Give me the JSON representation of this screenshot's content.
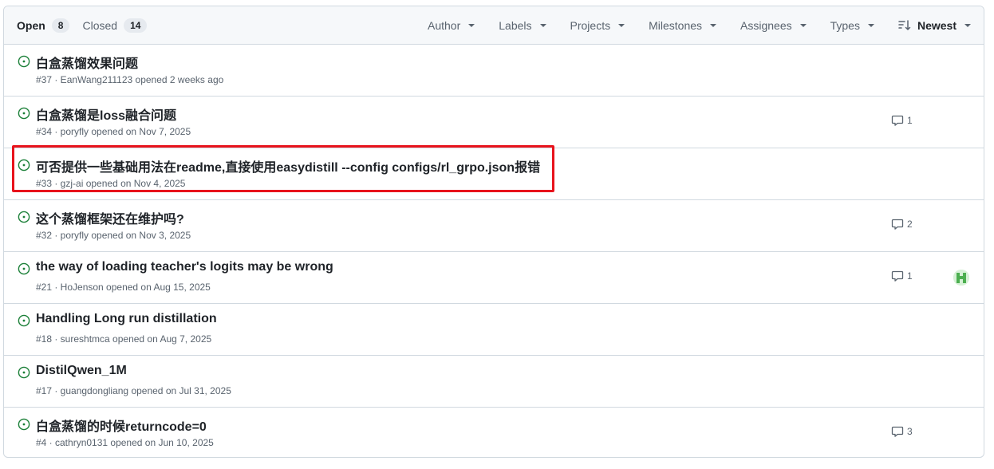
{
  "header": {
    "open_label": "Open",
    "open_count": "8",
    "closed_label": "Closed",
    "closed_count": "14",
    "filters": [
      "Author",
      "Labels",
      "Projects",
      "Milestones",
      "Assignees",
      "Types"
    ],
    "sort_label": "Newest"
  },
  "issues": [
    {
      "title": "白盒蒸馏效果问题",
      "meta": "#37 · EanWang211123 opened 2 weeks ago",
      "comments": ""
    },
    {
      "title": "白盒蒸馏是loss融合问题",
      "meta": "#34 · poryfly opened on Nov 7, 2025",
      "comments": "1"
    },
    {
      "title": "可否提供一些基础用法在readme,直接使用easydistill --config configs/rl_grpo.json报错",
      "meta": "#33 · gzj-ai opened on Nov 4, 2025",
      "comments": ""
    },
    {
      "title": "这个蒸馏框架还在维护吗?",
      "meta": "#32 · poryfly opened on Nov 3, 2025",
      "comments": "2"
    },
    {
      "title": "the way of loading teacher's logits may be wrong",
      "meta": "#21 · HoJenson opened on Aug 15, 2025",
      "comments": "1",
      "assignee": true
    },
    {
      "title": "Handling Long run distillation",
      "meta": "#18 · sureshtmca opened on Aug 7, 2025",
      "comments": ""
    },
    {
      "title": "DistilQwen_1M",
      "meta": "#17 · guangdongliang opened on Jul 31, 2025",
      "comments": ""
    },
    {
      "title": "白盒蒸馏的时候returncode=0",
      "meta": "#4 · cathryn0131 opened on Jun 10, 2025",
      "comments": "3"
    }
  ],
  "colors": {
    "open_icon": "#1a7f37",
    "highlight": "#e8131c"
  }
}
